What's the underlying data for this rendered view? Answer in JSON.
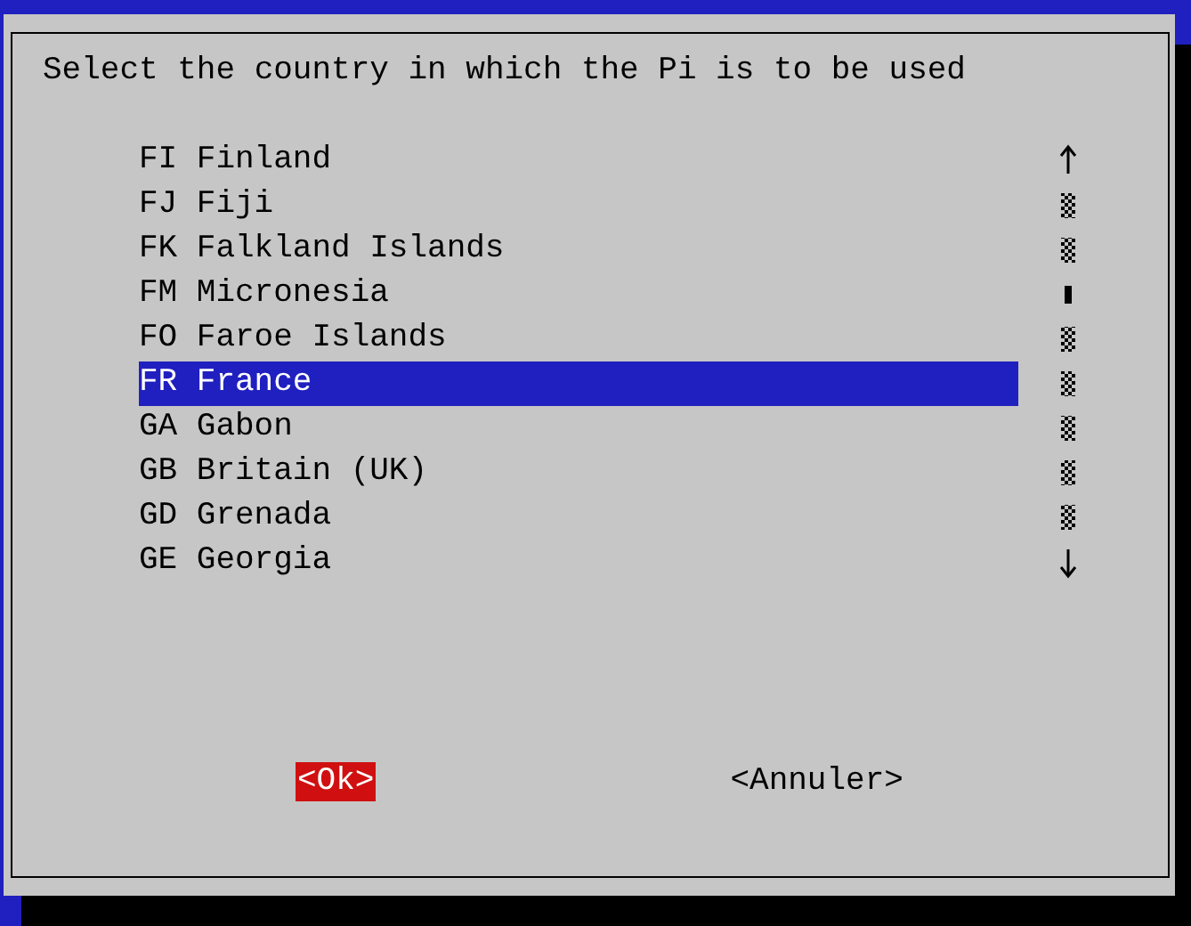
{
  "dialog": {
    "prompt": "Select the country in which the Pi is to be used",
    "items": [
      {
        "code": "FI",
        "name": "Finland",
        "selected": false
      },
      {
        "code": "FJ",
        "name": "Fiji",
        "selected": false
      },
      {
        "code": "FK",
        "name": "Falkland Islands",
        "selected": false
      },
      {
        "code": "FM",
        "name": "Micronesia",
        "selected": false
      },
      {
        "code": "FO",
        "name": "Faroe Islands",
        "selected": false
      },
      {
        "code": "FR",
        "name": "France",
        "selected": true
      },
      {
        "code": "GA",
        "name": "Gabon",
        "selected": false
      },
      {
        "code": "GB",
        "name": "Britain (UK)",
        "selected": false
      },
      {
        "code": "GD",
        "name": "Grenada",
        "selected": false
      },
      {
        "code": "GE",
        "name": "Georgia",
        "selected": false
      }
    ],
    "buttons": [
      {
        "label": "<Ok>",
        "selected": true
      },
      {
        "label": "<Annuler>",
        "selected": false
      }
    ]
  }
}
